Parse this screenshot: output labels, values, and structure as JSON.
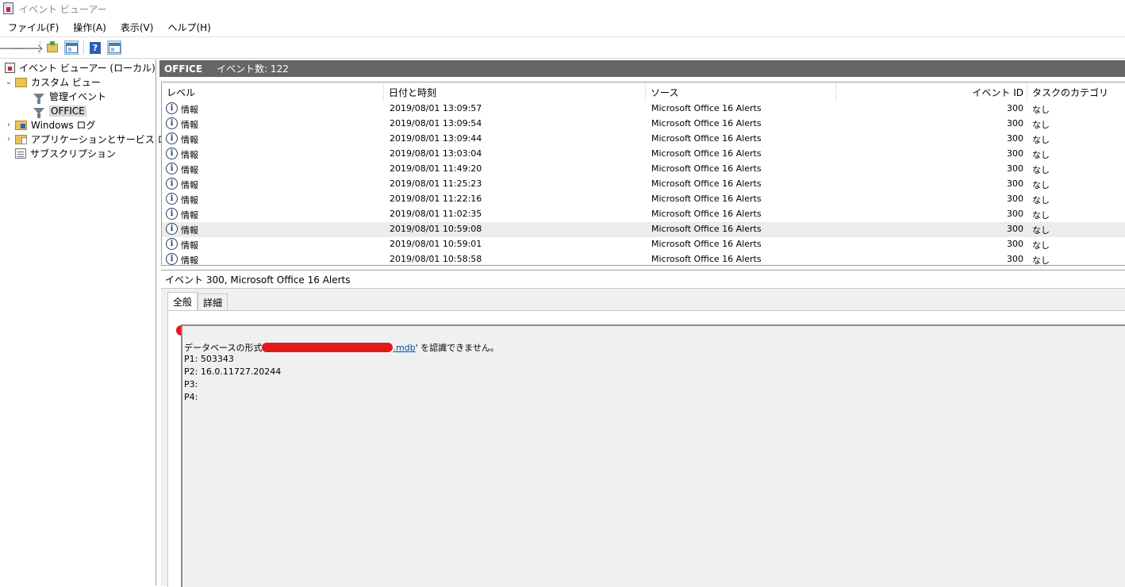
{
  "window": {
    "title": "イベント ビューアー"
  },
  "menu": [
    "ファイル(F)",
    "操作(A)",
    "表示(V)",
    "ヘルプ(H)"
  ],
  "toolbar": {
    "icons": [
      "back-arrow-icon",
      "forward-arrow-icon",
      "open-folder-icon",
      "console-tree-icon",
      "help-icon",
      "action-pane-icon"
    ]
  },
  "tree": {
    "root": "イベント ビューアー (ローカル)",
    "custom_views": "カスタム ビュー",
    "admin_events": "管理イベント",
    "office": "OFFICE",
    "windows_logs": "Windows ログ",
    "app_logs": "アプリケーションとサービス ログ",
    "subscriptions": "サブスクリプション"
  },
  "header": {
    "title": "OFFICE",
    "count": "イベント数: 122"
  },
  "columns": {
    "level": "レベル",
    "datetime": "日付と時刻",
    "source": "ソース",
    "event_id": "イベント ID",
    "category": "タスクのカテゴリ"
  },
  "events": [
    {
      "level": "情報",
      "datetime": "2019/08/01 13:09:57",
      "source": "Microsoft Office 16 Alerts",
      "id": "300",
      "category": "なし"
    },
    {
      "level": "情報",
      "datetime": "2019/08/01 13:09:54",
      "source": "Microsoft Office 16 Alerts",
      "id": "300",
      "category": "なし"
    },
    {
      "level": "情報",
      "datetime": "2019/08/01 13:09:44",
      "source": "Microsoft Office 16 Alerts",
      "id": "300",
      "category": "なし"
    },
    {
      "level": "情報",
      "datetime": "2019/08/01 13:03:04",
      "source": "Microsoft Office 16 Alerts",
      "id": "300",
      "category": "なし"
    },
    {
      "level": "情報",
      "datetime": "2019/08/01 11:49:20",
      "source": "Microsoft Office 16 Alerts",
      "id": "300",
      "category": "なし"
    },
    {
      "level": "情報",
      "datetime": "2019/08/01 11:25:23",
      "source": "Microsoft Office 16 Alerts",
      "id": "300",
      "category": "なし"
    },
    {
      "level": "情報",
      "datetime": "2019/08/01 11:22:16",
      "source": "Microsoft Office 16 Alerts",
      "id": "300",
      "category": "なし"
    },
    {
      "level": "情報",
      "datetime": "2019/08/01 11:02:35",
      "source": "Microsoft Office 16 Alerts",
      "id": "300",
      "category": "なし"
    },
    {
      "level": "情報",
      "datetime": "2019/08/01 10:59:08",
      "source": "Microsoft Office 16 Alerts",
      "id": "300",
      "category": "なし"
    },
    {
      "level": "情報",
      "datetime": "2019/08/01 10:59:01",
      "source": "Microsoft Office 16 Alerts",
      "id": "300",
      "category": "なし"
    },
    {
      "level": "情報",
      "datetime": "2019/08/01 10:58:58",
      "source": "Microsoft Office 16 Alerts",
      "id": "300",
      "category": "なし"
    }
  ],
  "detail": {
    "title": "イベント 300, Microsoft Office 16 Alerts",
    "tabs": [
      "全般",
      "詳細"
    ],
    "message": {
      "prefix": "データベースの形式",
      "link": ".mdb",
      "suffix": "' を認識できません。",
      "p1": "P1: 503343",
      "p2": "P2: 16.0.11727.20244",
      "p3": "P3:",
      "p4": "P4:"
    }
  },
  "colors": {
    "header_bg": "#666666",
    "redaction": "#e0191b",
    "link": "#0050a0",
    "selected_row": "#ececec"
  }
}
